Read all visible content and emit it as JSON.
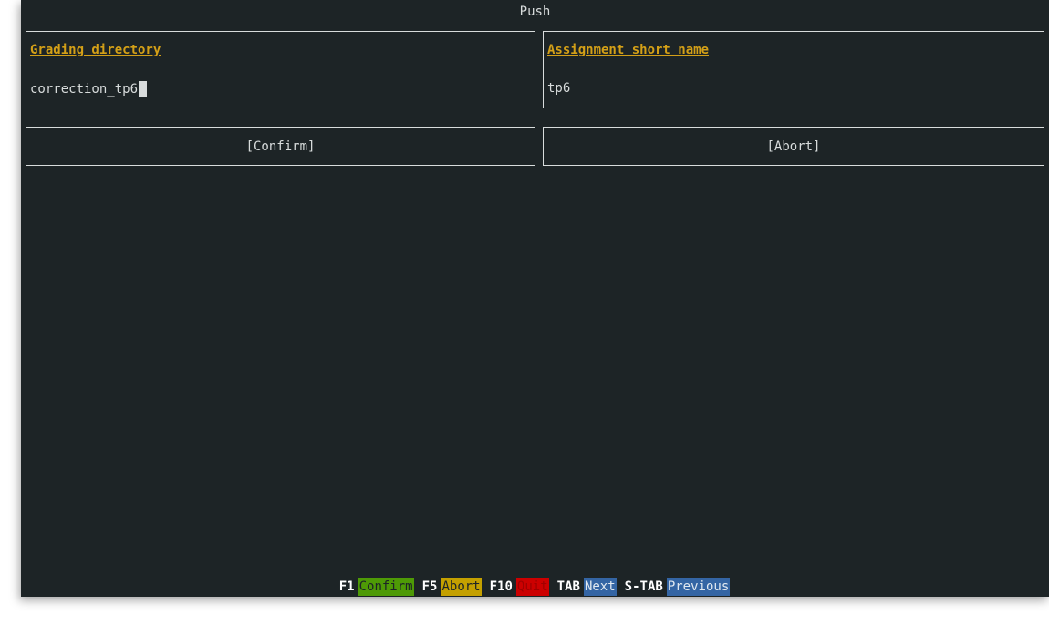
{
  "window": {
    "title": "Push"
  },
  "fields": {
    "grading_directory": {
      "label": "Grading directory",
      "value": "correction_tp6"
    },
    "assignment_short_name": {
      "label": "Assignment short name",
      "value": "tp6"
    }
  },
  "buttons": {
    "confirm": "[Confirm]",
    "abort": "[Abort]"
  },
  "footer": {
    "shortcuts": [
      {
        "key": "F1",
        "action": "Confirm",
        "color": "#4e9a06"
      },
      {
        "key": "F5",
        "action": "Abort",
        "color": "#c4a000"
      },
      {
        "key": "F10",
        "action": "Quit",
        "color": "#cc0000"
      },
      {
        "key": "TAB",
        "action": "Next",
        "color": "#3465a4"
      },
      {
        "key": "S-TAB",
        "action": "Previous",
        "color": "#3465a4"
      }
    ]
  }
}
